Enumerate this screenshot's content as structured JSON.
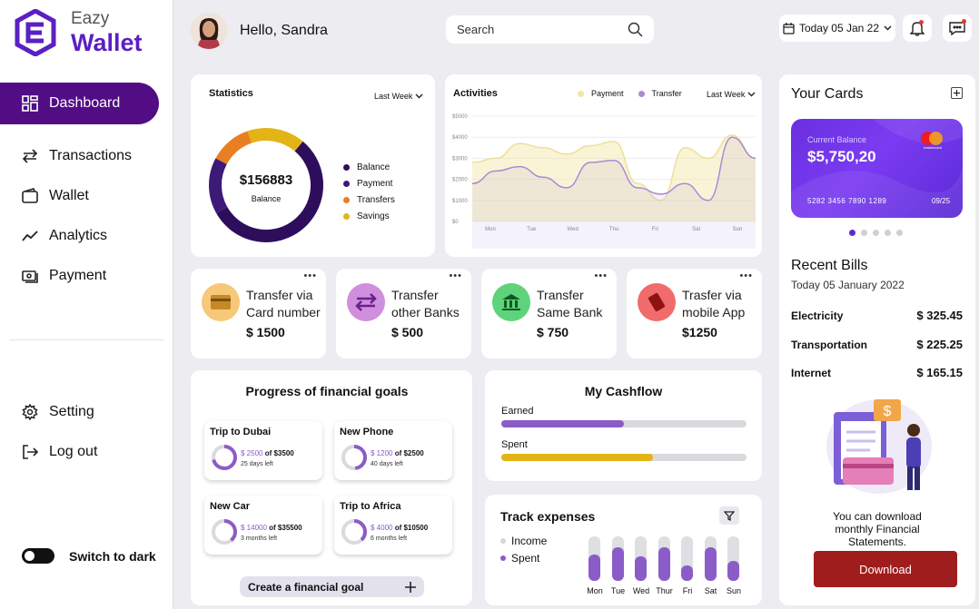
{
  "brand": {
    "top": "Eazy",
    "main": "Wallet"
  },
  "nav": [
    {
      "label": "Dashboard",
      "icon": "grid-icon",
      "active": true
    },
    {
      "label": "Transactions",
      "icon": "arrows-icon"
    },
    {
      "label": "Wallet",
      "icon": "wallet-icon"
    },
    {
      "label": "Analytics",
      "icon": "trend-icon"
    },
    {
      "label": "Payment",
      "icon": "payment-icon"
    }
  ],
  "nav_bottom": [
    {
      "label": "Setting",
      "icon": "gear-icon"
    },
    {
      "label": "Log out",
      "icon": "logout-icon"
    }
  ],
  "theme_toggle": {
    "label": "Switch to dark",
    "on": false
  },
  "header": {
    "greeting": "Hello, Sandra",
    "search_placeholder": "Search",
    "date": "Today 05 Jan 22"
  },
  "statistics": {
    "title": "Statistics",
    "period": "Last Week",
    "total": "$156883",
    "total_label": "Balance",
    "legend": [
      {
        "label": "Balance",
        "color": "#2e0e5c"
      },
      {
        "label": "Payment",
        "color": "#3d1a78"
      },
      {
        "label": "Transfers",
        "color": "#e87f22"
      },
      {
        "label": "Savings",
        "color": "#e3b416"
      }
    ]
  },
  "chart_data": {
    "type": "area",
    "title": "Activities",
    "x": [
      "Mon",
      "Tue",
      "Wed",
      "Thu",
      "Fri",
      "Sat",
      "Sun"
    ],
    "ylim": [
      0,
      5000
    ],
    "yticks": [
      "$0",
      "$1000",
      "$2000",
      "$3000",
      "$4000",
      "$5000"
    ],
    "series": [
      {
        "name": "Payment",
        "color": "#f1e7a5",
        "values": [
          2800,
          3000,
          3700,
          3500,
          3200,
          3600,
          3800,
          1800,
          1000,
          3500,
          3000,
          4100,
          3000
        ]
      },
      {
        "name": "Transfer",
        "color": "#a98ad8",
        "values": [
          1800,
          2400,
          2600,
          2100,
          1600,
          2800,
          2900,
          1600,
          1300,
          1800,
          1000,
          4000,
          3000
        ]
      }
    ],
    "period": "Last Week",
    "grid": true
  },
  "transfers": [
    {
      "title": "Transfer via Card number",
      "amount": "$ 1500",
      "icon": "card-icon",
      "color": "#f6c879"
    },
    {
      "title": "Transfer other Banks",
      "amount": "$ 500",
      "icon": "exchange-icon",
      "color": "#cf8fdc"
    },
    {
      "title": "Transfer Same Bank",
      "amount": "$ 750",
      "icon": "bank-icon",
      "color": "#5fd37a"
    },
    {
      "title": "Trasfer via mobile App",
      "amount": "$1250",
      "icon": "mobile-icon",
      "color": "#f06b6b"
    }
  ],
  "goals": {
    "title": "Progress of financial goals",
    "items": [
      {
        "name": "Trip to Dubai",
        "saved": "$ 2500",
        "target": "of $3500",
        "left": "25 days left",
        "progress": 0.71
      },
      {
        "name": "New Phone",
        "saved": "$ 1200",
        "target": "of $2500",
        "left": "40 days left",
        "progress": 0.48
      },
      {
        "name": "New Car",
        "saved": "$ 14000",
        "target": "of $35500",
        "left": "3 months left",
        "progress": 0.39
      },
      {
        "name": "Trip to Africa",
        "saved": "$ 4000",
        "target": "of $10500",
        "left": "6 months left",
        "progress": 0.38
      }
    ],
    "create_label": "Create a financial goal"
  },
  "cashflow": {
    "title": "My Cashflow",
    "rows": [
      {
        "label": "Earned",
        "value": 0.5,
        "color": "#8b5cc7"
      },
      {
        "label": "Spent",
        "value": 0.6,
        "color": "#e3b416"
      }
    ]
  },
  "expenses": {
    "title": "Track expenses",
    "legend": [
      {
        "label": "Income",
        "color": "#d6d6db"
      },
      {
        "label": "Spent",
        "color": "#8b5cc7"
      }
    ],
    "days": [
      "Mon",
      "Tue",
      "Wed",
      "Thur",
      "Fri",
      "Sat",
      "Sun"
    ],
    "spent": [
      0.6,
      0.75,
      0.55,
      0.75,
      0.35,
      0.75,
      0.45
    ]
  },
  "cards": {
    "title": "Your Cards",
    "balance_label": "Current Balance",
    "balance": "$5,750,20",
    "number": "5282 3456 7890 1289",
    "expiry": "09/25",
    "network": "mastercard"
  },
  "bills": {
    "title": "Recent Bills",
    "date": "Today 05 January 2022",
    "items": [
      {
        "name": "Electricity",
        "amount": "$ 325.45"
      },
      {
        "name": "Transportation",
        "amount": "$ 225.25"
      },
      {
        "name": "Internet",
        "amount": "$ 165.15"
      }
    ]
  },
  "download": {
    "text": "You can download monthly Financial Statements.",
    "button": "Download"
  }
}
